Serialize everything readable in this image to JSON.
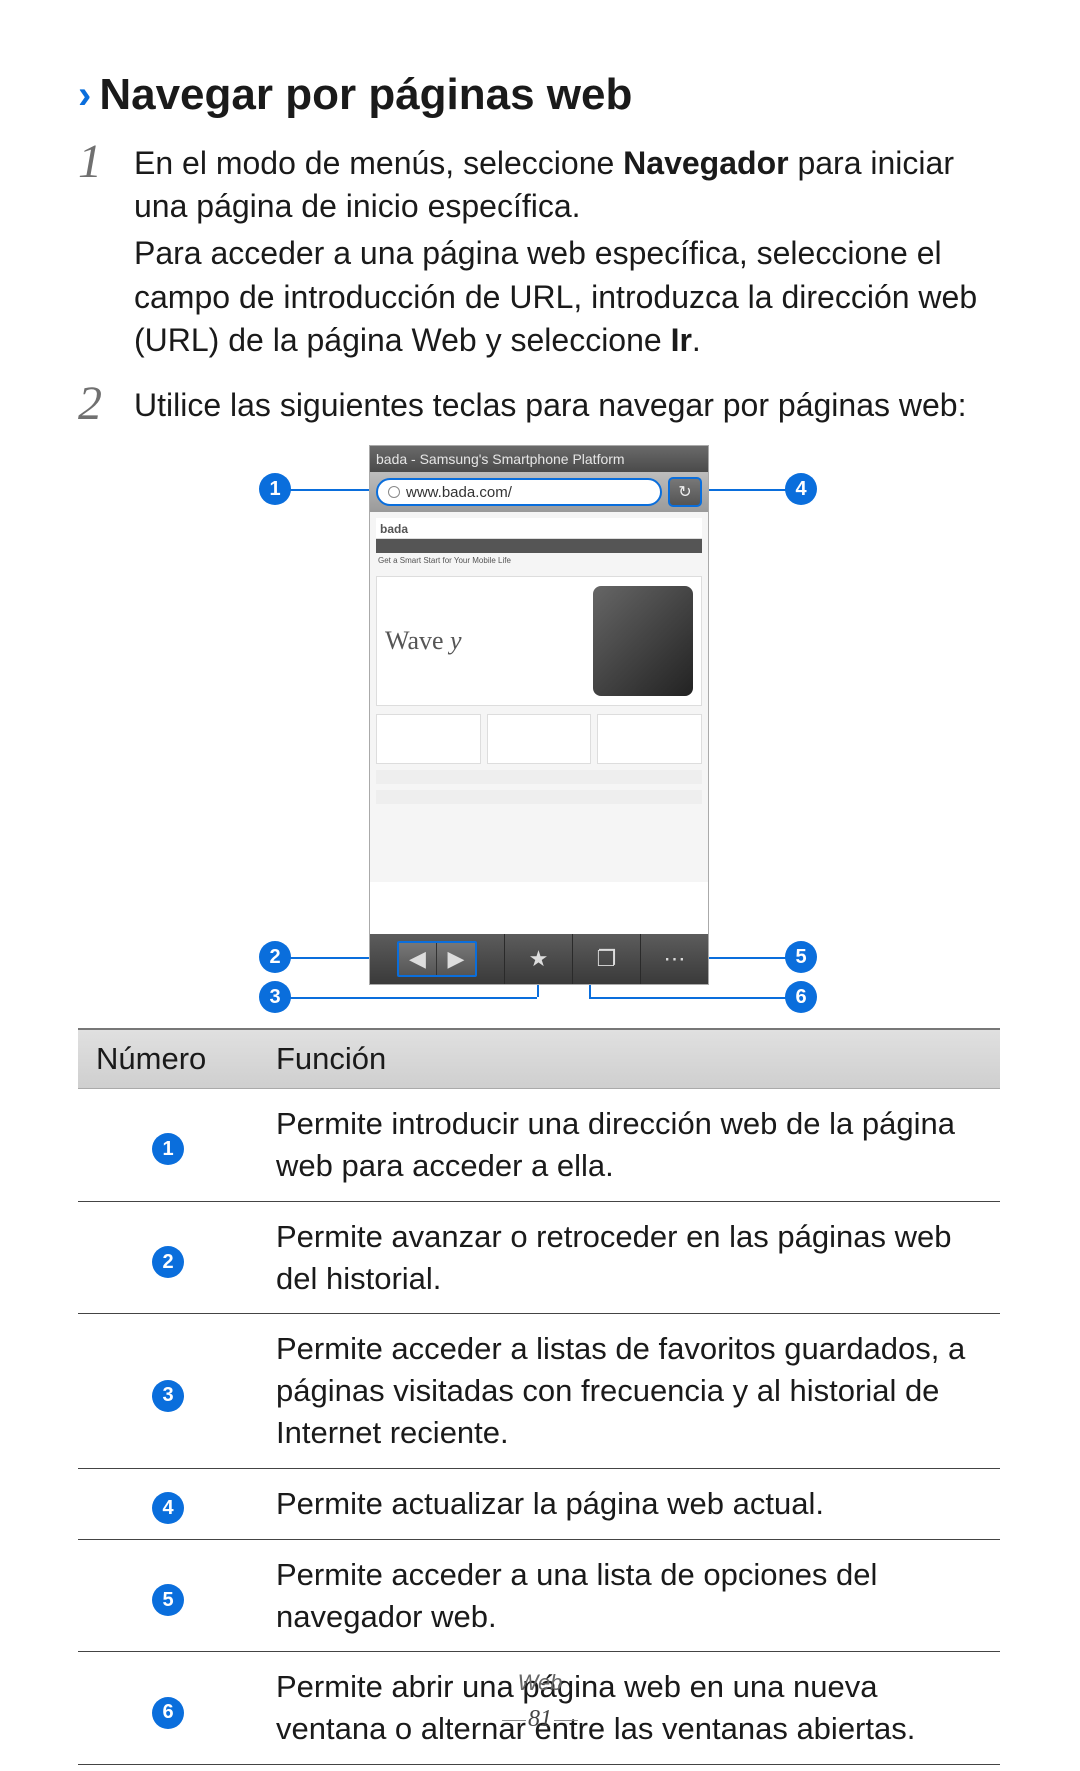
{
  "heading": "Navegar por páginas web",
  "step1": {
    "num": "1",
    "p1_a": "En el modo de menús, seleccione ",
    "p1_bold": "Navegador",
    "p1_b": " para iniciar una página de inicio específica.",
    "p2_a": "Para acceder a una página web específica, seleccione el campo de introducción de URL, introduzca la dirección web (URL) de la página Web y seleccione ",
    "p2_bold": "Ir",
    "p2_b": "."
  },
  "step2": {
    "num": "2",
    "text": "Utilice las siguientes teclas para navegar por páginas web:"
  },
  "phone": {
    "title": "bada - Samsung's Smartphone Platform",
    "url": "www.bada.com/",
    "brand": "bada",
    "hero_label_a": "Wave ",
    "hero_label_b": "y",
    "hero_caption": "Get a Smart Start for Your Mobile Life"
  },
  "callouts": {
    "c1": "1",
    "c2": "2",
    "c3": "3",
    "c4": "4",
    "c5": "5",
    "c6": "6"
  },
  "table": {
    "head_num": "Número",
    "head_func": "Función",
    "rows": [
      {
        "n": "1",
        "f": "Permite introducir una dirección web de la página web para acceder a ella."
      },
      {
        "n": "2",
        "f": "Permite avanzar o retroceder en las páginas web del historial."
      },
      {
        "n": "3",
        "f": "Permite acceder a listas de favoritos guardados, a páginas visitadas con frecuencia y al historial de Internet reciente."
      },
      {
        "n": "4",
        "f": "Permite actualizar la página web actual."
      },
      {
        "n": "5",
        "f": "Permite acceder a una lista de opciones del navegador web."
      },
      {
        "n": "6",
        "f": "Permite abrir una página web en una nueva ventana o alternar entre las ventanas abiertas."
      }
    ]
  },
  "footer": {
    "section": "Web",
    "page": "81"
  },
  "icons": {
    "refresh": "↻",
    "back": "◀",
    "forward": "▶",
    "star": "★",
    "windows": "❐",
    "more": "⋯"
  }
}
